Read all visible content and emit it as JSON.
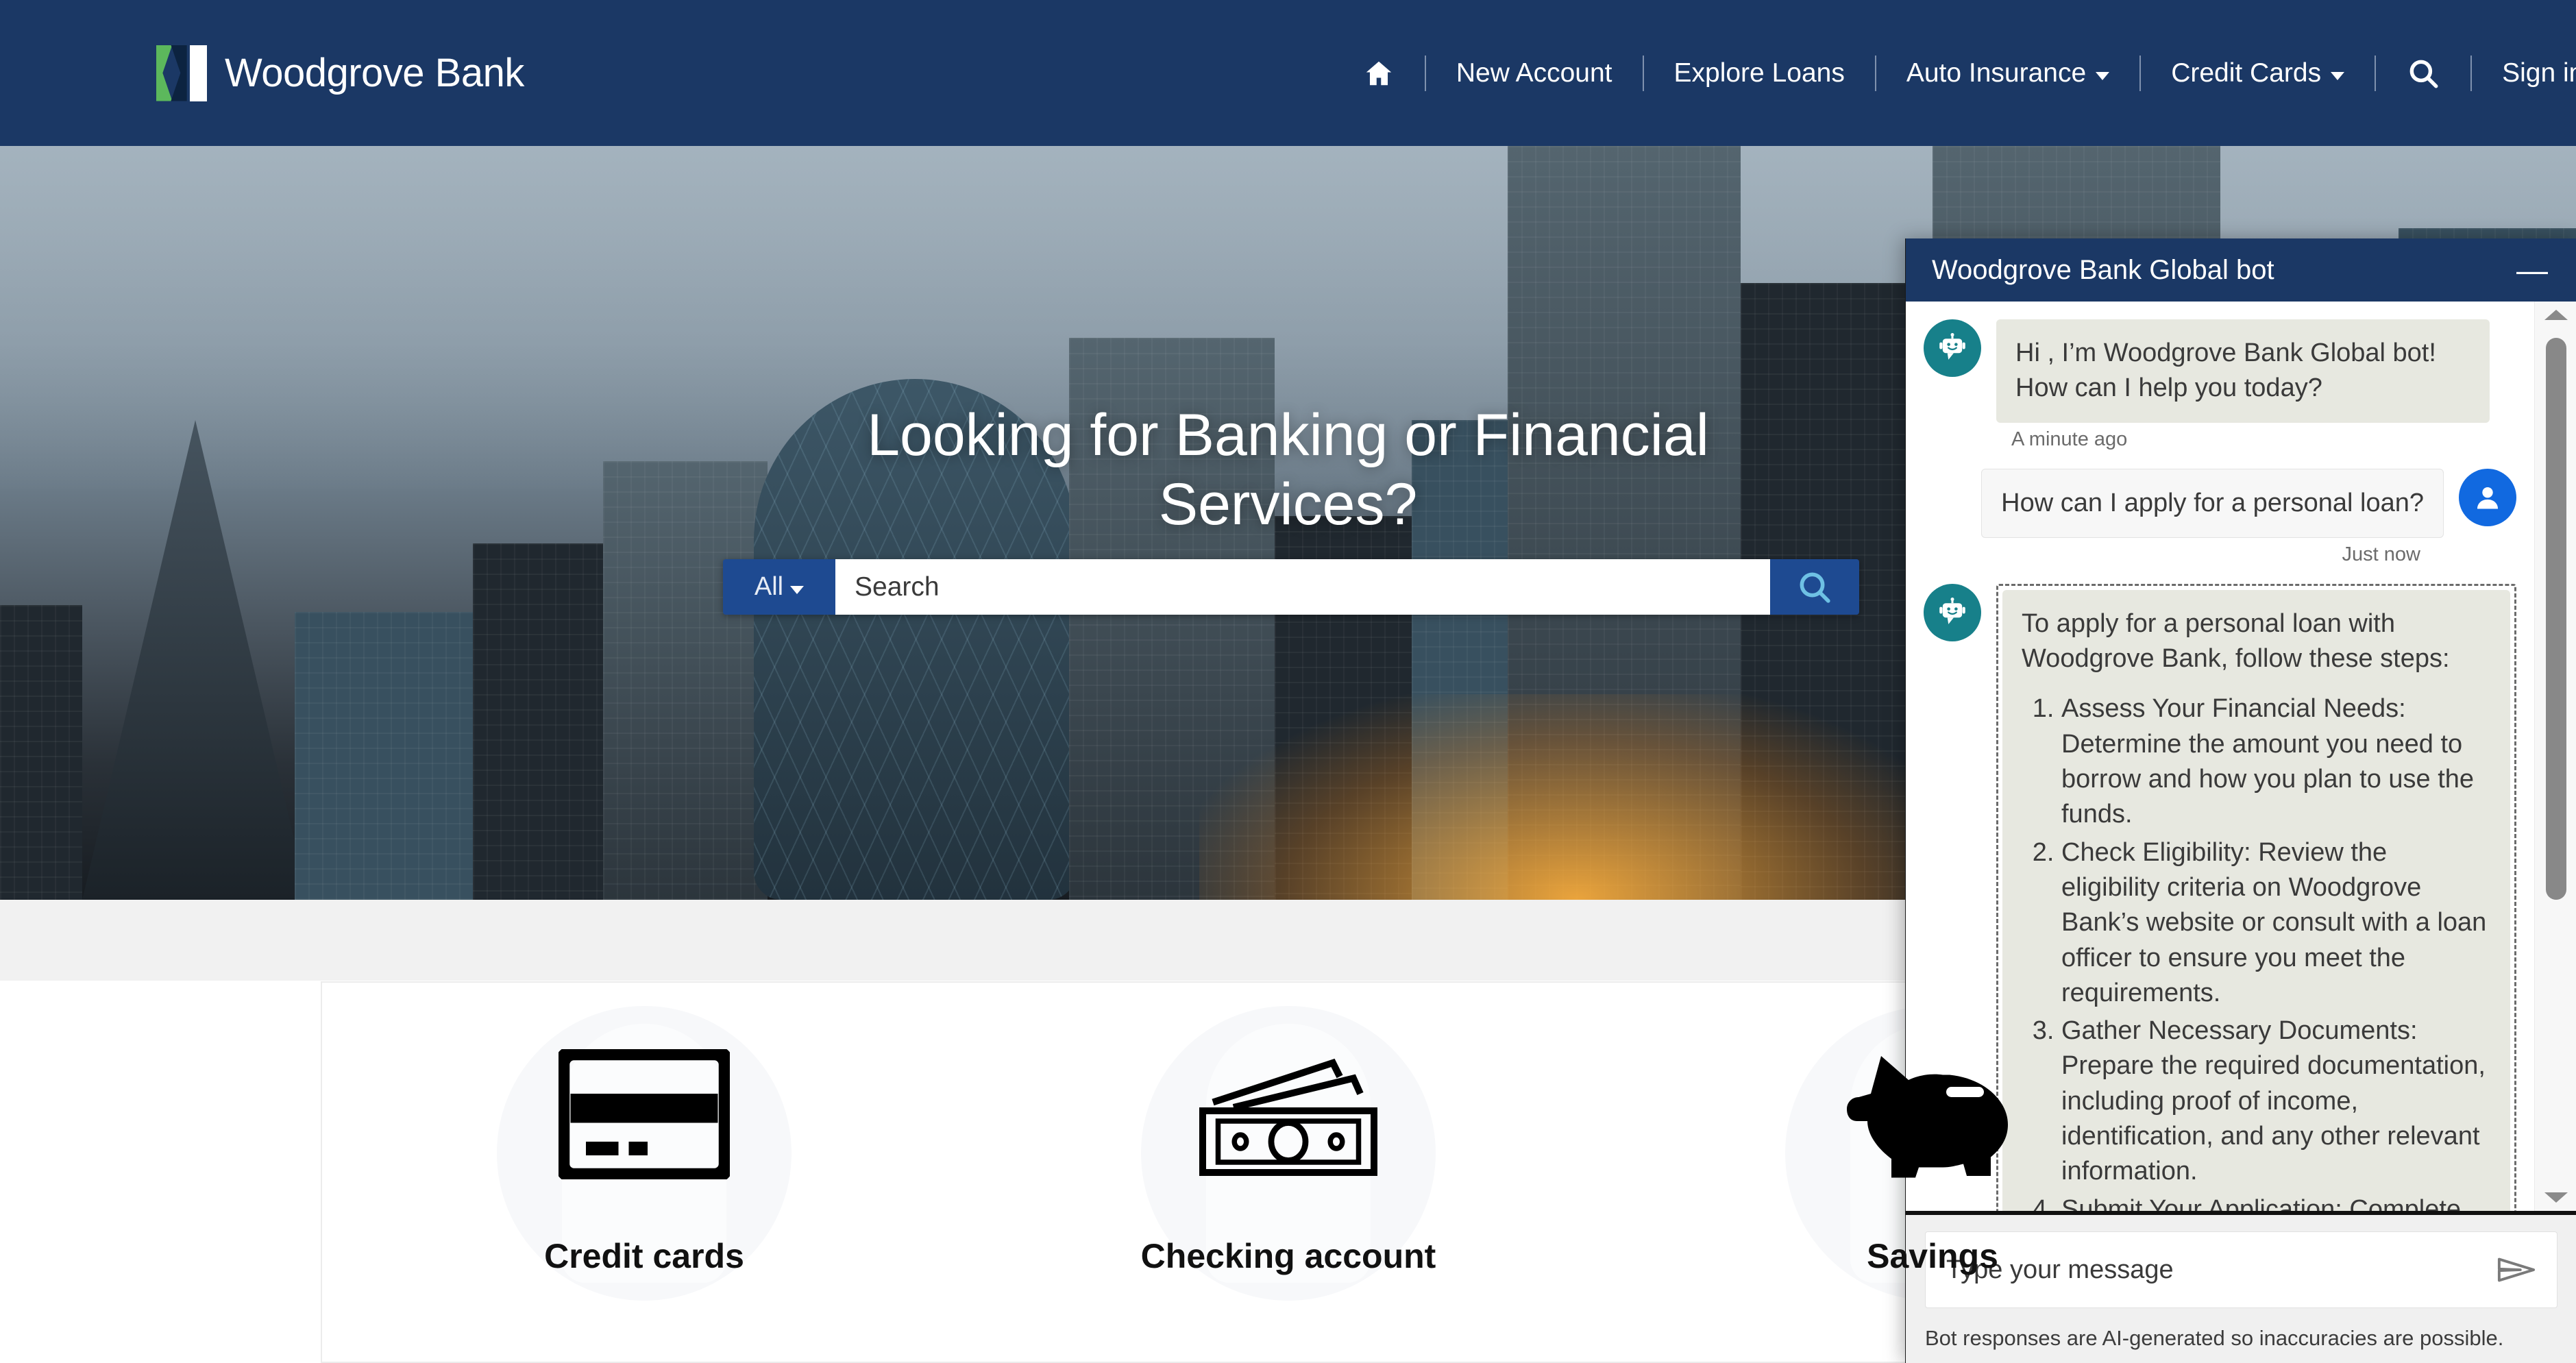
{
  "brand": {
    "name": "Woodgrove Bank"
  },
  "nav": {
    "home_icon": "home-icon",
    "items": [
      {
        "label": "New Account",
        "has_caret": false
      },
      {
        "label": "Explore Loans",
        "has_caret": false
      },
      {
        "label": "Auto Insurance",
        "has_caret": true
      },
      {
        "label": "Credit Cards",
        "has_caret": true
      }
    ],
    "search_icon": "search-icon",
    "signin_label": "Sign in"
  },
  "hero": {
    "title_line1": "Looking for Banking or Financial",
    "title_line2": "Services?",
    "search": {
      "scope_label": "All",
      "placeholder": "Search",
      "value": "",
      "button_icon": "search-icon"
    }
  },
  "cards": [
    {
      "label": "Credit cards",
      "icon": "credit-card-icon"
    },
    {
      "label": "Checking account",
      "icon": "banknotes-icon"
    },
    {
      "label": "Savings",
      "icon": "piggy-bank-icon"
    }
  ],
  "chat": {
    "title": "Woodgrove Bank Global bot",
    "minimize_icon": "minimize-icon",
    "messages": [
      {
        "sender": "bot",
        "text": "Hi , I’m Woodgrove Bank Global bot! How can I help you today?",
        "timestamp": "A minute ago"
      },
      {
        "sender": "user",
        "text": "How can I apply for a personal loan?",
        "timestamp": "Just now"
      }
    ],
    "answer": {
      "intro": "To apply for a personal loan with Woodgrove Bank, follow these steps:",
      "steps": [
        "Assess Your Financial Needs: Determine the amount you need to borrow and how you plan to use the funds.",
        "Check Eligibility: Review the eligibility criteria on Woodgrove Bank’s website or consult with a loan officer to ensure you meet the requirements.",
        "Gather Necessary Documents: Prepare the required documentation, including proof of income, identification, and any other relevant information.",
        "Submit Your Application: Complete the online application form or visit any Woodgrove Bank branch to apply in"
      ]
    },
    "input": {
      "placeholder": "Type your message",
      "value": "",
      "send_icon": "send-icon"
    },
    "disclaimer": "Bot responses are AI-generated so inaccuracies are possible.",
    "scrollbar": {
      "up_icon": "chevron-up-icon",
      "down_icon": "chevron-down-icon"
    }
  },
  "colors": {
    "header_navy": "#1b3865",
    "accent_blue": "#1e4a91",
    "bot_avatar_teal": "#17808a",
    "user_avatar_blue": "#1169e0",
    "logo_green": "#5cb85c",
    "bubble_bot": "#e7e8e0"
  }
}
